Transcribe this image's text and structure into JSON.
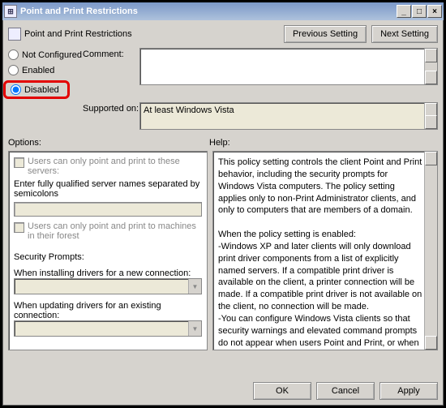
{
  "window": {
    "title": "Point and Print Restrictions"
  },
  "header": {
    "title": "Point and Print Restrictions"
  },
  "nav": {
    "previous": "Previous Setting",
    "next": "Next Setting"
  },
  "state": {
    "not_configured": "Not Configured",
    "enabled": "Enabled",
    "disabled": "Disabled",
    "selected": "disabled"
  },
  "labels": {
    "comment": "Comment:",
    "supported": "Supported on:",
    "options": "Options:",
    "help": "Help:"
  },
  "supported_text": "At least Windows Vista",
  "options": {
    "servers_check": "Users can only point and print to these servers:",
    "servers_hint": "Enter fully qualified server names separated by semicolons",
    "forest_check": "Users can only point and print to machines in their forest",
    "security_prompts": "Security Prompts:",
    "install_label": "When installing drivers for a new connection:",
    "update_label": "When updating drivers for an existing connection:"
  },
  "help_text": "This policy setting controls the client Point and Print behavior, including the security prompts for Windows Vista computers. The policy setting applies only to non-Print Administrator clients, and only to computers that are members of a domain.\n\nWhen the policy setting is enabled:\n-Windows XP and later clients will only download print driver components from a list of explicitly named servers. If a compatible print driver is available on the client, a printer connection will be made. If a compatible print driver is not available on the client, no connection will be made.\n-You can configure Windows Vista clients so that security warnings and elevated command prompts do not appear when users Point and Print, or when printer connection drivers need to be updated.\n\nWhen the policy setting is not configured:\n-Windows Vista client computers can point and print to any server.",
  "footer": {
    "ok": "OK",
    "cancel": "Cancel",
    "apply": "Apply"
  }
}
